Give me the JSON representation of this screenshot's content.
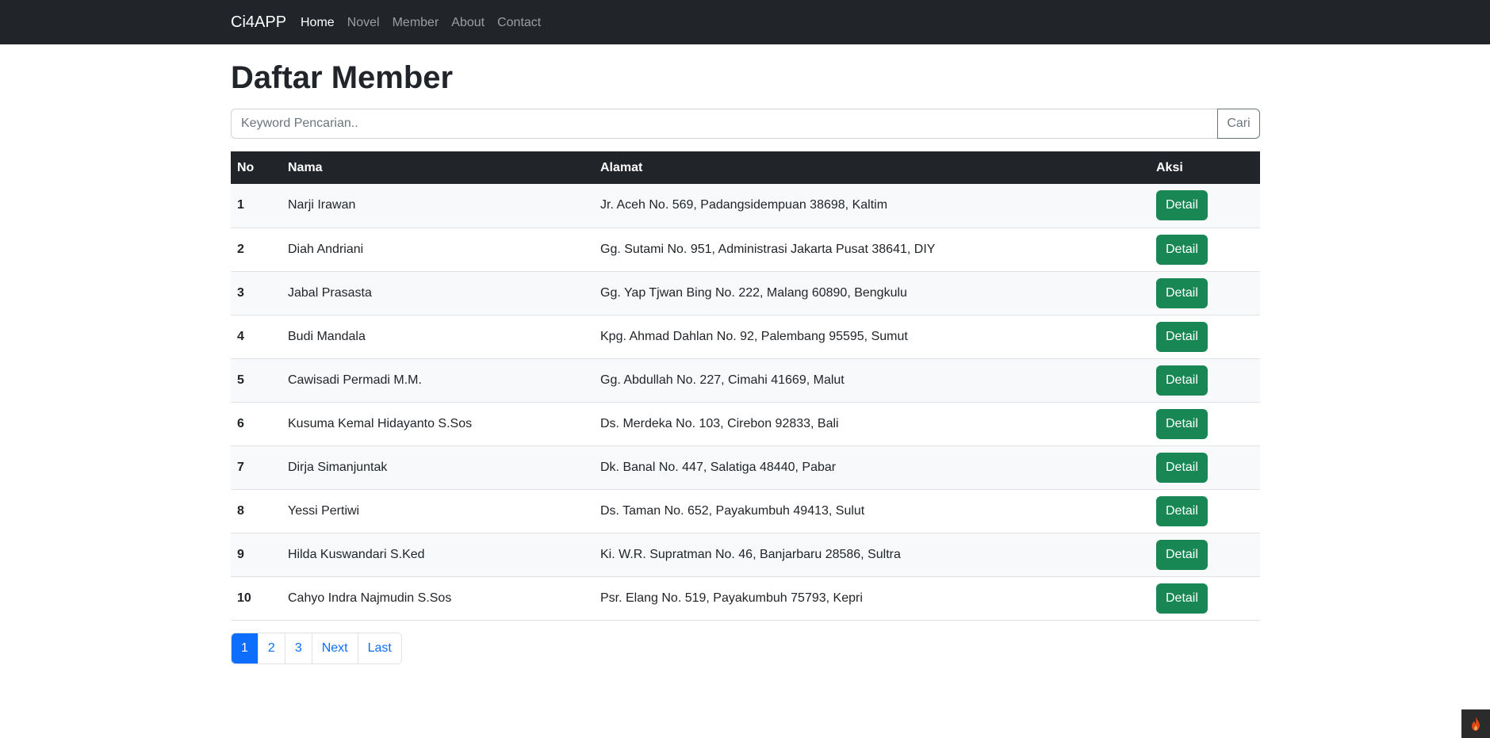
{
  "navbar": {
    "brand": "Ci4APP",
    "links": [
      {
        "label": "Home",
        "active": true
      },
      {
        "label": "Novel",
        "active": false
      },
      {
        "label": "Member",
        "active": false
      },
      {
        "label": "About",
        "active": false
      },
      {
        "label": "Contact",
        "active": false
      }
    ]
  },
  "page": {
    "title": "Daftar Member"
  },
  "search": {
    "placeholder": "Keyword Pencarian..",
    "value": "",
    "button_label": "Cari"
  },
  "table": {
    "headers": [
      "No",
      "Nama",
      "Alamat",
      "Aksi"
    ],
    "rows": [
      {
        "no": "1",
        "nama": "Narji Irawan",
        "alamat": "Jr. Aceh No. 569, Padangsidempuan 38698, Kaltim",
        "action": "Detail"
      },
      {
        "no": "2",
        "nama": "Diah Andriani",
        "alamat": "Gg. Sutami No. 951, Administrasi Jakarta Pusat 38641, DIY",
        "action": "Detail"
      },
      {
        "no": "3",
        "nama": "Jabal Prasasta",
        "alamat": "Gg. Yap Tjwan Bing No. 222, Malang 60890, Bengkulu",
        "action": "Detail"
      },
      {
        "no": "4",
        "nama": "Budi Mandala",
        "alamat": "Kpg. Ahmad Dahlan No. 92, Palembang 95595, Sumut",
        "action": "Detail"
      },
      {
        "no": "5",
        "nama": "Cawisadi Permadi M.M.",
        "alamat": "Gg. Abdullah No. 227, Cimahi 41669, Malut",
        "action": "Detail"
      },
      {
        "no": "6",
        "nama": "Kusuma Kemal Hidayanto S.Sos",
        "alamat": "Ds. Merdeka No. 103, Cirebon 92833, Bali",
        "action": "Detail"
      },
      {
        "no": "7",
        "nama": "Dirja Simanjuntak",
        "alamat": "Dk. Banal No. 447, Salatiga 48440, Pabar",
        "action": "Detail"
      },
      {
        "no": "8",
        "nama": "Yessi Pertiwi",
        "alamat": "Ds. Taman No. 652, Payakumbuh 49413, Sulut",
        "action": "Detail"
      },
      {
        "no": "9",
        "nama": "Hilda Kuswandari S.Ked",
        "alamat": "Ki. W.R. Supratman No. 46, Banjarbaru 28586, Sultra",
        "action": "Detail"
      },
      {
        "no": "10",
        "nama": "Cahyo Indra Najmudin S.Sos",
        "alamat": "Psr. Elang No. 519, Payakumbuh 75793, Kepri",
        "action": "Detail"
      }
    ]
  },
  "pagination": {
    "items": [
      {
        "label": "1",
        "active": true
      },
      {
        "label": "2",
        "active": false
      },
      {
        "label": "3",
        "active": false
      },
      {
        "label": "Next",
        "active": false
      },
      {
        "label": "Last",
        "active": false
      }
    ]
  },
  "debug_toolbar": {
    "icon": "flame-icon"
  },
  "colors": {
    "navbar_bg": "#212529",
    "primary": "#0d6efd",
    "success": "#198754",
    "debug_icon": "#dd4814"
  }
}
